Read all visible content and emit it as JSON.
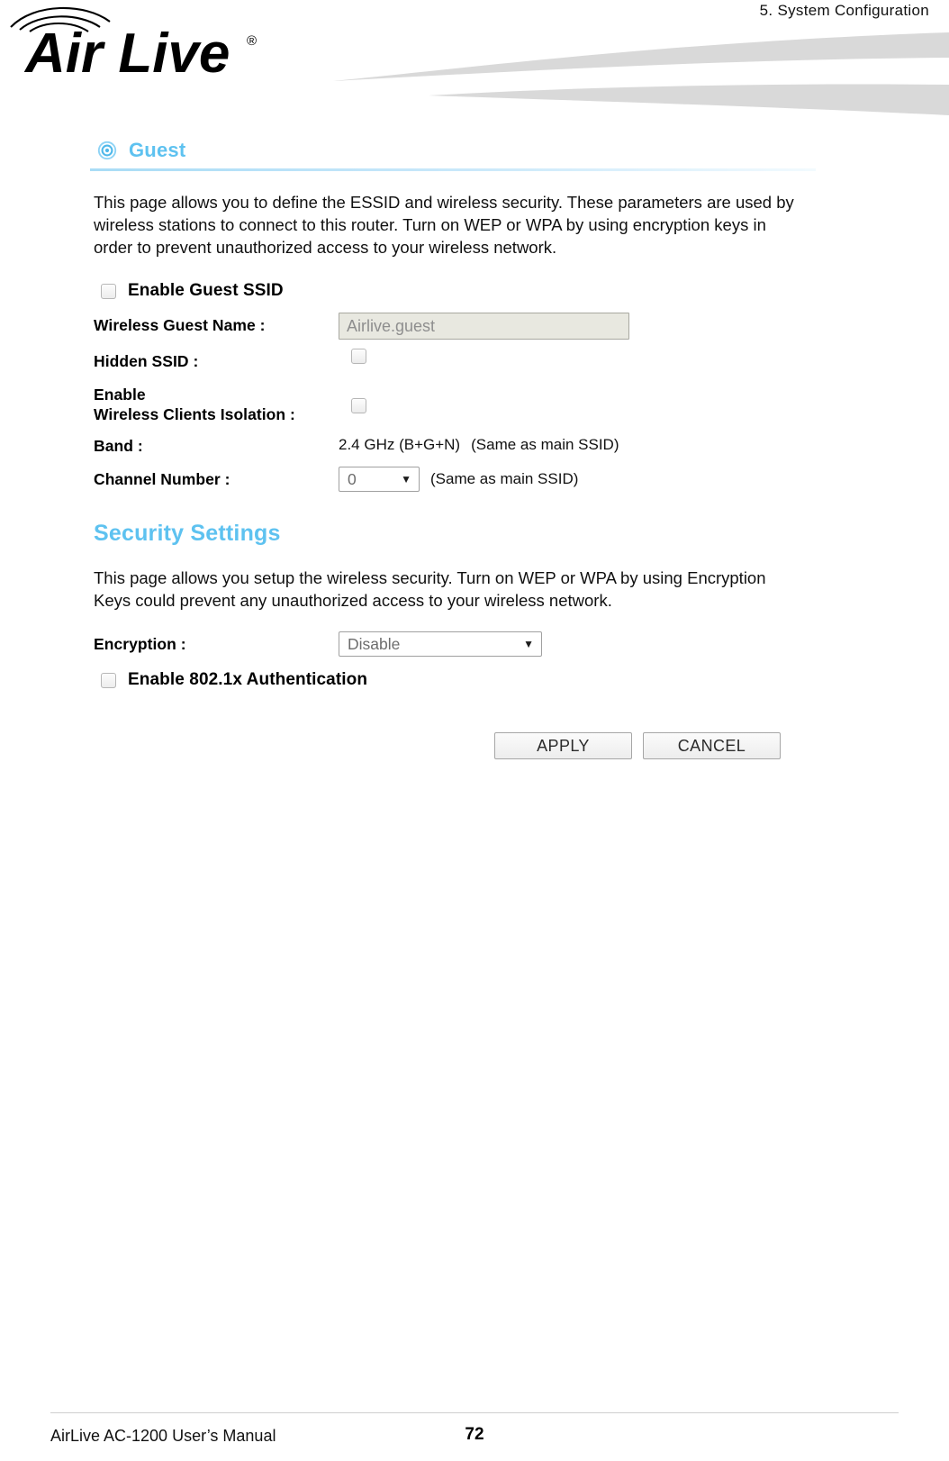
{
  "header": {
    "running_head": "5.  System  Configuration",
    "logo_text": "AirLive",
    "logo_mark": "®"
  },
  "section": {
    "icon": "target-icon",
    "title": "Guest",
    "description": "This page allows you to define the ESSID and wireless security. These parameters are used by wireless stations to connect to this router.  Turn on WEP or WPA by using encryption keys in order to prevent unauthorized access to your wireless network."
  },
  "guest_form": {
    "enable_guest_ssid_label": "Enable Guest SSID",
    "enable_guest_ssid_checked": false,
    "wireless_guest_name_label": "Wireless Guest Name :",
    "wireless_guest_name_value": "Airlive.guest",
    "hidden_ssid_label": "Hidden SSID :",
    "hidden_ssid_checked": false,
    "isolation_label_line1": "Enable",
    "isolation_label_line2": "Wireless Clients Isolation :",
    "isolation_checked": false,
    "band_label": "Band :",
    "band_value": "2.4 GHz (B+G+N)",
    "band_note": "(Same as main SSID)",
    "channel_label": "Channel Number :",
    "channel_value": "0",
    "channel_note": "(Same as main SSID)",
    "dropdown_arrow": "▼"
  },
  "security": {
    "heading": "Security Settings",
    "description": "This page allows you setup the wireless security. Turn on WEP or WPA by using Encryption Keys could prevent any unauthorized access to your wireless network.",
    "encryption_label": "Encryption :",
    "encryption_value": "Disable",
    "dot1x_label": "Enable 802.1x Authentication",
    "dot1x_checked": false
  },
  "buttons": {
    "apply": "APPLY",
    "cancel": "CANCEL"
  },
  "footer": {
    "manual": "AirLive AC-1200 User’s Manual",
    "page_number": "72"
  },
  "colors": {
    "accent_blue": "#5ec2f0",
    "swoosh_gray": "#d9d9d9",
    "field_gray": "#e8e8e0"
  }
}
